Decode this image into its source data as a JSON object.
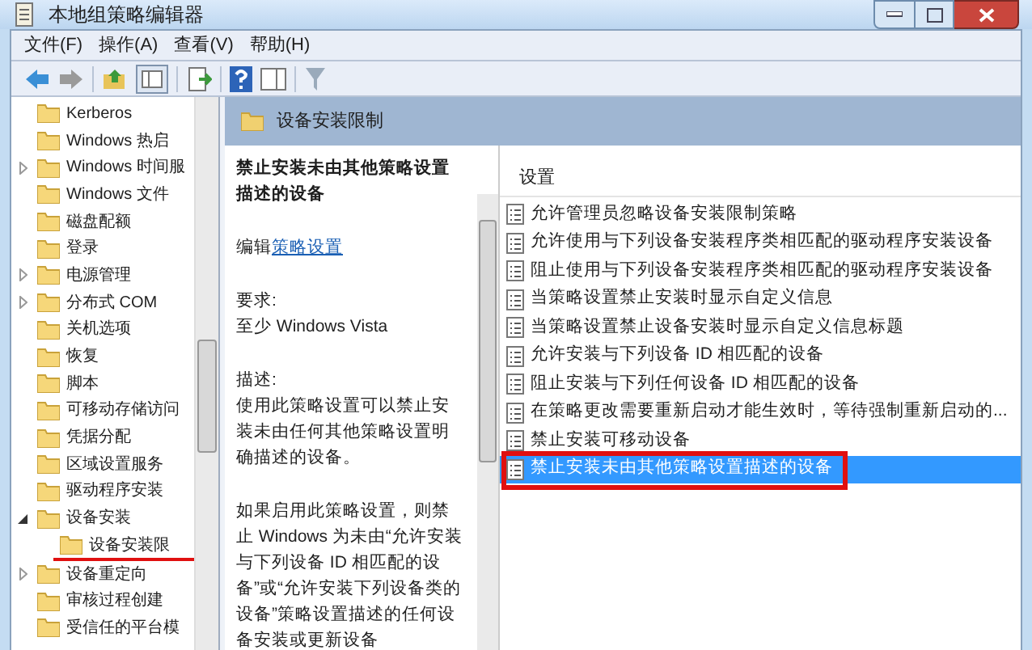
{
  "window": {
    "title": "本地组策略编辑器"
  },
  "menu": [
    "文件(F)",
    "操作(A)",
    "查看(V)",
    "帮助(H)"
  ],
  "tree": {
    "items": [
      {
        "label": "Kerberos",
        "kind": "leaf"
      },
      {
        "label": "Windows 热启",
        "kind": "leaf"
      },
      {
        "label": "Windows 时间服",
        "kind": "branch",
        "expanded": false
      },
      {
        "label": "Windows 文件",
        "kind": "leaf"
      },
      {
        "label": "磁盘配额",
        "kind": "leaf"
      },
      {
        "label": "登录",
        "kind": "leaf"
      },
      {
        "label": "电源管理",
        "kind": "branch",
        "expanded": false
      },
      {
        "label": "分布式 COM",
        "kind": "branch",
        "expanded": false
      },
      {
        "label": "关机选项",
        "kind": "leaf"
      },
      {
        "label": "恢复",
        "kind": "leaf"
      },
      {
        "label": "脚本",
        "kind": "leaf"
      },
      {
        "label": "可移动存储访问",
        "kind": "leaf"
      },
      {
        "label": "凭据分配",
        "kind": "leaf"
      },
      {
        "label": "区域设置服务",
        "kind": "leaf"
      },
      {
        "label": "驱动程序安装",
        "kind": "leaf"
      },
      {
        "label": "设备安装",
        "kind": "branch",
        "expanded": true,
        "children": [
          {
            "label": "设备安装限",
            "kind": "leaf"
          }
        ]
      },
      {
        "label": "设备重定向",
        "kind": "branch",
        "expanded": false
      },
      {
        "label": "审核过程创建",
        "kind": "leaf"
      },
      {
        "label": "受信任的平台模",
        "kind": "leaf"
      }
    ]
  },
  "header": {
    "title": "设备安装限制"
  },
  "description": {
    "title": "禁止安装未由其他策略设置描述的设备",
    "edit_prefix": "编辑",
    "edit_link": "策略设置",
    "requirements_label": "要求:",
    "requirements": "至少 Windows Vista",
    "description_label": "描述:",
    "paragraphs": [
      "使用此策略设置可以禁止安装未由任何其他策略设置明确描述的设备。",
      "如果启用此策略设置，则禁止 Windows 为未由“允许安装与下列设备 ID 相匹配的设备”或“允许安装下列设备类的设备”策略设置描述的任何设备安装或更新设备"
    ]
  },
  "settings": {
    "column": "设置",
    "items": [
      {
        "label": "允许管理员忽略设备安装限制策略",
        "selected": false
      },
      {
        "label": "允许使用与下列设备安装程序类相匹配的驱动程序安装设备",
        "selected": false
      },
      {
        "label": "阻止使用与下列设备安装程序类相匹配的驱动程序安装设备",
        "selected": false
      },
      {
        "label": "当策略设置禁止安装时显示自定义信息",
        "selected": false
      },
      {
        "label": "当策略设置禁止设备安装时显示自定义信息标题",
        "selected": false
      },
      {
        "label": "允许安装与下列设备 ID 相匹配的设备",
        "selected": false
      },
      {
        "label": "阻止安装与下列任何设备 ID 相匹配的设备",
        "selected": false
      },
      {
        "label": "在策略更改需要重新启动才能生效时，等待强制重新启动的...",
        "selected": false
      },
      {
        "label": "禁止安装可移动设备",
        "selected": false
      },
      {
        "label": "禁止安装未由其他策略设置描述的设备",
        "selected": true
      }
    ]
  }
}
